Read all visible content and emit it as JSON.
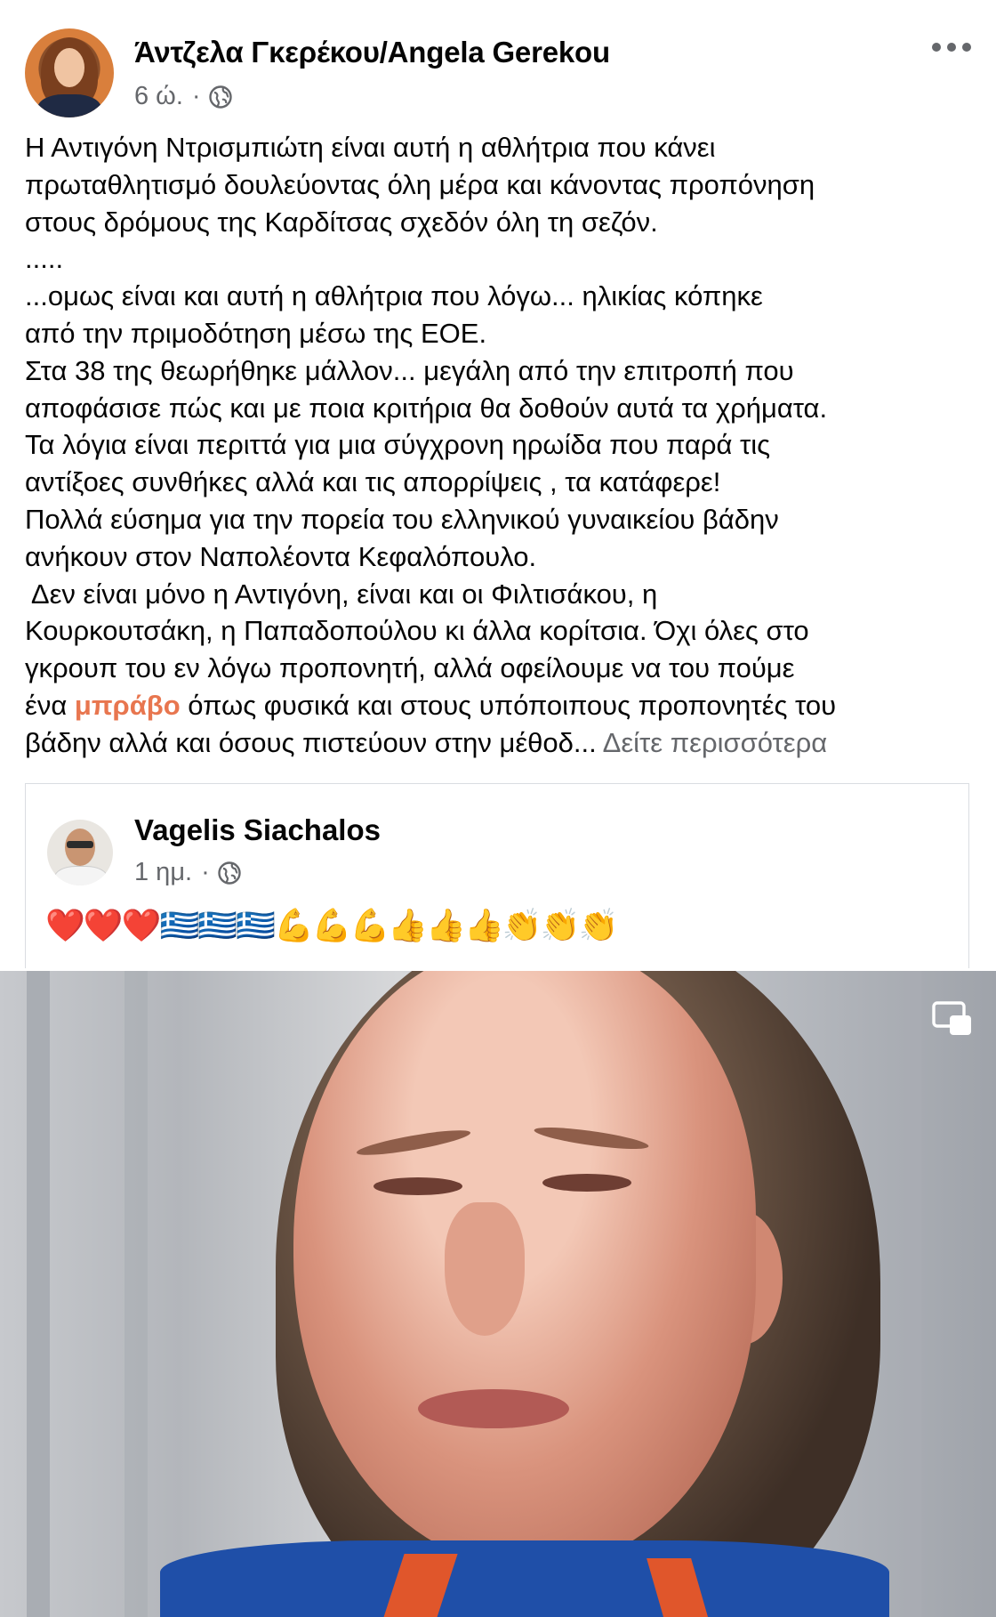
{
  "post": {
    "author_name": "Άντζελα Γκερέκου/Angela Gerekou",
    "timestamp": "6 ώ.",
    "separator": "·",
    "privacy_icon": "globe-icon",
    "more_icon": "more-options-icon",
    "body_lines": [
      "Η Αντιγόνη Ντρισμπιώτη είναι αυτή η αθλήτρια που  κάνει",
      "πρωταθλητισμό δουλεύοντας όλη μέρα και κάνοντας προπόνηση",
      "στους δρόμους της Καρδίτσας σχεδόν όλη τη σεζόν.",
      ".....",
      "...ομως είναι και  αυτή η αθλήτρια  που λόγω... ηλικίας κόπηκε",
      "από την πριμοδότηση μέσω της ΕΟΕ.",
      "Στα 38 της θεωρήθηκε μάλλον... μεγάλη από την επιτροπή που",
      "αποφάσισε πώς και με ποια κριτήρια θα δοθούν αυτά τα χρήματα.",
      "Τα λόγια είναι περιττά για μια σύγχρονη ηρωίδα που παρά τις",
      "αντίξοες  συνθήκες αλλά και τις απορρίψεις , τα κατάφερε!",
      "Πολλά εύσημα για την πορεία του ελληνικού γυναικείου βάδην",
      "ανήκουν στον Ναπολέοντα Κεφαλόπουλο.",
      " Δεν είναι μόνο η Αντιγόνη, είναι και οι Φιλτισάκου, η",
      "Κουρκουτσάκη, η Παπαδοπούλου κι άλλα κορίτσια. Όχι όλες στο",
      "γκρουπ του εν λόγω προπονητή, αλλά οφείλουμε να του πούμε"
    ],
    "line_16_before": "ένα ",
    "line_16_highlight": "μπράβο",
    "line_16_after": " όπως φυσικά και στους υπόποιπους προπονητές του",
    "line_17_text": "βάδην αλλά και όσους πιστεύουν στην μέθοδ... ",
    "see_more": "Δείτε περισσότερα",
    "highlight_color": "#e8764f"
  },
  "shared": {
    "author_name": "Vagelis Siachalos",
    "timestamp": "1 ημ.",
    "separator": "·",
    "privacy_icon": "globe-icon",
    "emojis": "❤️❤️❤️🇬🇷🇬🇷🇬🇷💪💪💪👍👍👍👏👏👏"
  },
  "media": {
    "pip_icon": "picture-in-picture-icon"
  }
}
